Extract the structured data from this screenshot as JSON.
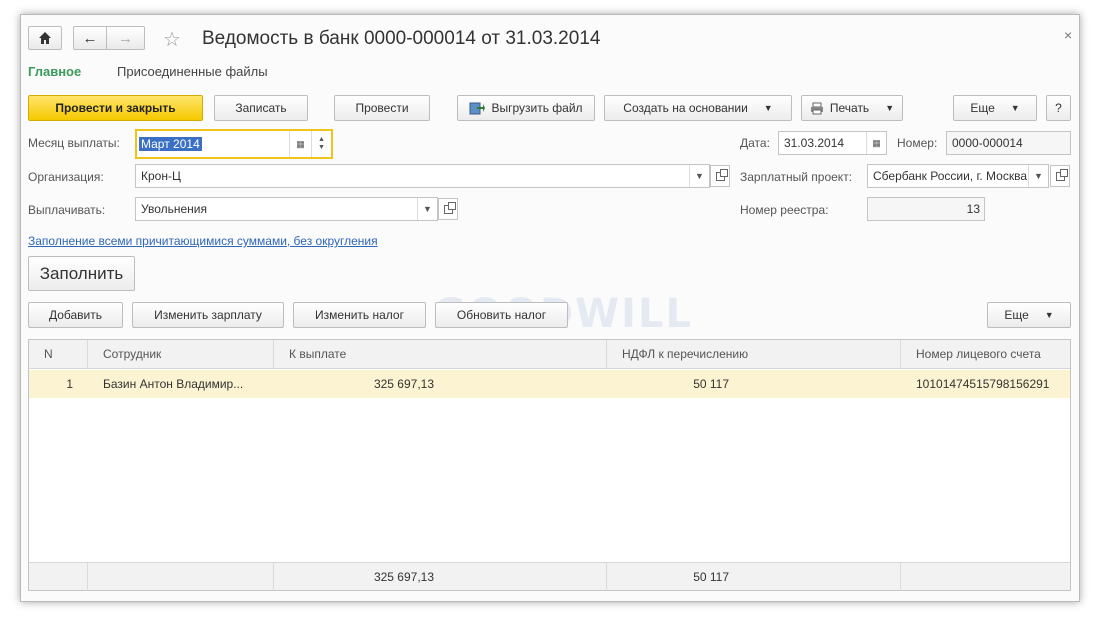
{
  "window": {
    "title": "Ведомость в банк 0000-000014 от 31.03.2014",
    "close_glyph": "×"
  },
  "tabs": [
    {
      "label": "Главное",
      "active": true
    },
    {
      "label": "Присоединенные файлы",
      "active": false
    }
  ],
  "toolbar": {
    "post_close": "Провести и закрыть",
    "write": "Записать",
    "post": "Провести",
    "export": "Выгрузить файл",
    "create_based": "Создать на основании",
    "print": "Печать",
    "more": "Еще",
    "help": "?"
  },
  "form": {
    "month_label": "Месяц выплаты:",
    "month_value": "Март 2014",
    "date_label": "Дата:",
    "date_value": "31.03.2014",
    "number_label": "Номер:",
    "number_value": "0000-000014",
    "org_label": "Организация:",
    "org_value": "Крон-Ц",
    "salary_project_label": "Зарплатный проект:",
    "salary_project_value": "Сбербанк России, г. Москва",
    "pay_label": "Выплачивать:",
    "pay_value": "Увольнения",
    "registry_label": "Номер реестра:",
    "registry_value": "13",
    "fill_link": "Заполнение всеми причитающимися суммами, без округления",
    "fill_button": "Заполнить"
  },
  "table_toolbar": {
    "add": "Добавить",
    "change_salary": "Изменить зарплату",
    "change_tax": "Изменить налог",
    "update_tax": "Обновить налог",
    "more": "Еще"
  },
  "table": {
    "headers": [
      "N",
      "Сотрудник",
      "К выплате",
      "НДФЛ к перечислению",
      "Номер лицевого счета"
    ],
    "rows": [
      {
        "n": "1",
        "employee": "Базин Антон Владимир...",
        "amount": "325 697,13",
        "ndfl": "50 117",
        "account": "10101474515798156291"
      }
    ],
    "totals": {
      "amount": "325 697,13",
      "ndfl": "50 117"
    }
  },
  "watermark": "GOODWILL",
  "colors": {
    "accent_green": "#3a9a5c",
    "primary_button": "#f5c900",
    "link": "#2f67b8",
    "focus": "#f0c419"
  }
}
